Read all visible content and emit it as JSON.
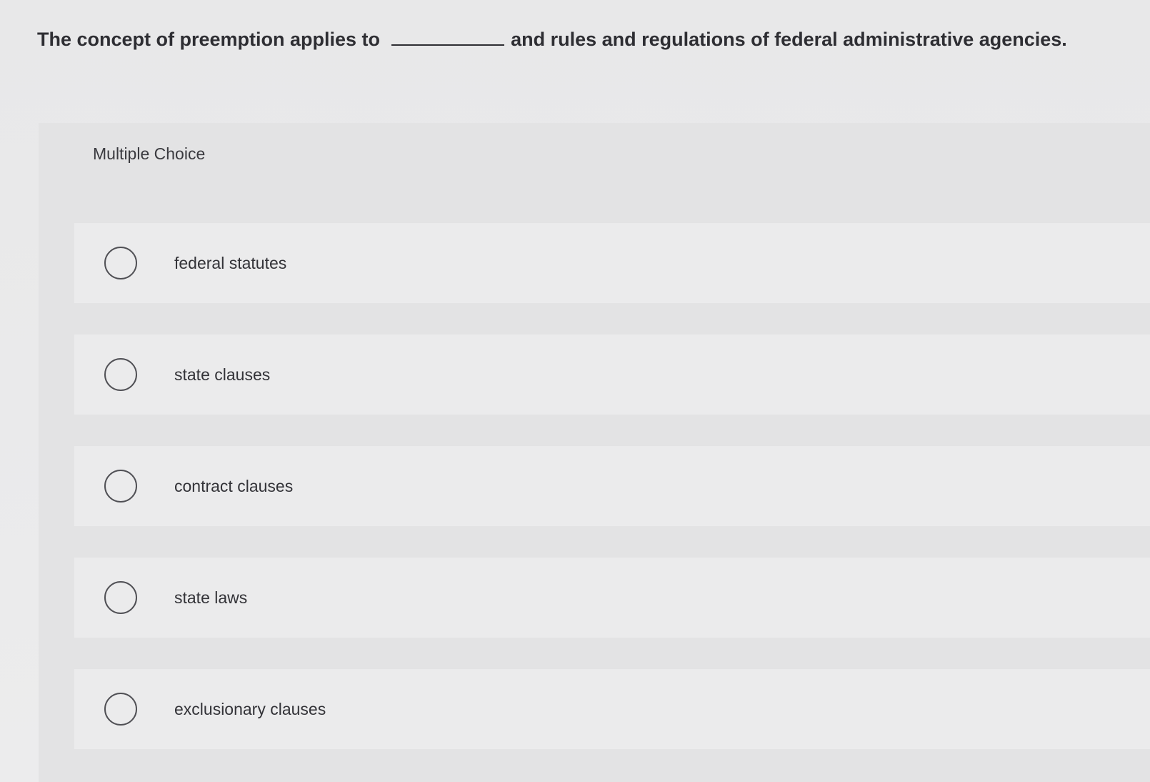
{
  "question": {
    "text_before_blank": "The concept of preemption applies to",
    "text_after_blank": "and rules and regulations of federal administrative agencies."
  },
  "section_label": "Multiple Choice",
  "options": [
    {
      "label": "federal statutes"
    },
    {
      "label": "state clauses"
    },
    {
      "label": "contract clauses"
    },
    {
      "label": "state laws"
    },
    {
      "label": "exclusionary clauses"
    }
  ]
}
